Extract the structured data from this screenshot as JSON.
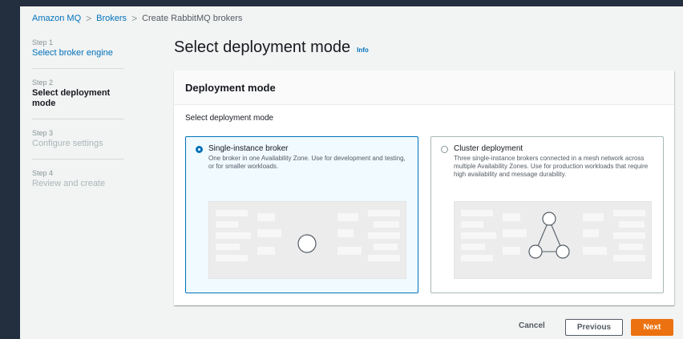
{
  "breadcrumb": {
    "items": [
      "Amazon MQ",
      "Brokers",
      "Create RabbitMQ brokers"
    ]
  },
  "steps": [
    {
      "num": "Step 1",
      "label": "Select broker engine",
      "state": "done"
    },
    {
      "num": "Step 2",
      "label": "Select deployment mode",
      "state": "current"
    },
    {
      "num": "Step 3",
      "label": "Configure settings",
      "state": "future"
    },
    {
      "num": "Step 4",
      "label": "Review and create",
      "state": "future"
    }
  ],
  "page": {
    "title": "Select deployment mode",
    "info_link": "Info"
  },
  "panel": {
    "header": "Deployment mode",
    "field_label": "Select deployment mode",
    "options": [
      {
        "title": "Single-instance broker",
        "description": "One broker in one Availability Zone. Use for development and testing, or for smaller workloads.",
        "selected": true,
        "illustration_icon": "single-node-icon"
      },
      {
        "title": "Cluster deployment",
        "description": "Three single-instance brokers connected in a mesh network across multiple Availability Zones. Use for production workloads that require high availability and message durability.",
        "selected": false,
        "illustration_icon": "cluster-nodes-icon"
      }
    ]
  },
  "footer": {
    "cancel": "Cancel",
    "previous": "Previous",
    "next": "Next"
  },
  "colors": {
    "accent": "#0073bb",
    "primary_button": "#ec7211",
    "background": "#232f3e"
  }
}
